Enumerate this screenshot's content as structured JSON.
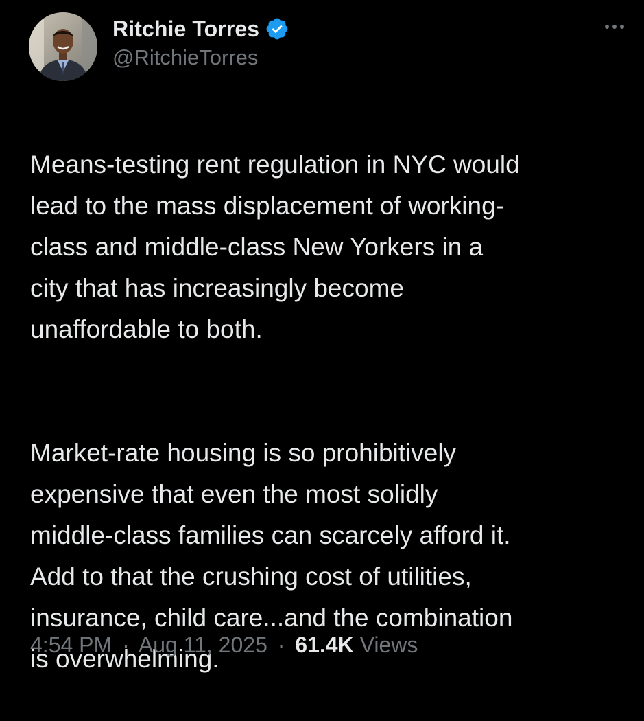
{
  "author": {
    "name": "Ritchie Torres",
    "handle": "@RitchieTorres",
    "verified": true,
    "avatar_icon": "profile-photo"
  },
  "colors": {
    "background": "#000000",
    "text_primary": "#e7e9ea",
    "text_secondary": "#71767b",
    "verified_badge": "#1d9bf0"
  },
  "more_icon": "more-horizontal-icon",
  "tweet": {
    "paragraph_1": "Means-testing rent regulation in NYC would\nlead to the mass displacement of working-\nclass and middle-class New Yorkers in a\ncity that has increasingly become\nunaffordable to both.",
    "paragraph_2": "Market-rate housing is so prohibitively\nexpensive that even the most solidly\nmiddle-class families can scarcely afford it.\nAdd to that the crushing cost of utilities,\ninsurance, child care...and the combination\nis overwhelming."
  },
  "meta": {
    "time": "4:54 PM",
    "separator": "·",
    "date": "Aug 11, 2025",
    "views_count": "61.4K",
    "views_label": "Views"
  }
}
